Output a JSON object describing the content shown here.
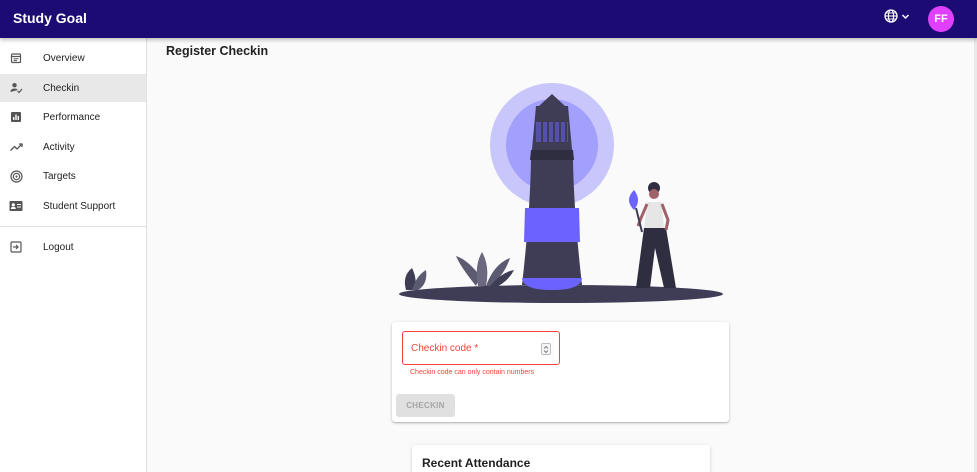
{
  "app": {
    "title": "Study Goal"
  },
  "header": {
    "avatar_initials": "FF",
    "language_icon": "globe-icon"
  },
  "sidebar": {
    "items": [
      {
        "label": "Overview",
        "icon": "calendar-icon"
      },
      {
        "label": "Checkin",
        "icon": "person-check-icon",
        "active": true
      },
      {
        "label": "Performance",
        "icon": "bar-chart-icon"
      },
      {
        "label": "Activity",
        "icon": "trending-up-icon"
      },
      {
        "label": "Targets",
        "icon": "target-icon"
      },
      {
        "label": "Student Support",
        "icon": "contact-card-icon"
      }
    ],
    "logout": {
      "label": "Logout",
      "icon": "logout-icon"
    }
  },
  "main": {
    "title": "Register Checkin",
    "form": {
      "field_label": "Checkin code *",
      "error": "Checkin code can only contain numbers",
      "button": "CHECKIN"
    },
    "recent": {
      "title": "Recent Attendance"
    }
  },
  "colors": {
    "appbar": "#1c0b73",
    "accent": "#6c63ff",
    "error": "#f44336",
    "avatar": "#e040fb"
  }
}
